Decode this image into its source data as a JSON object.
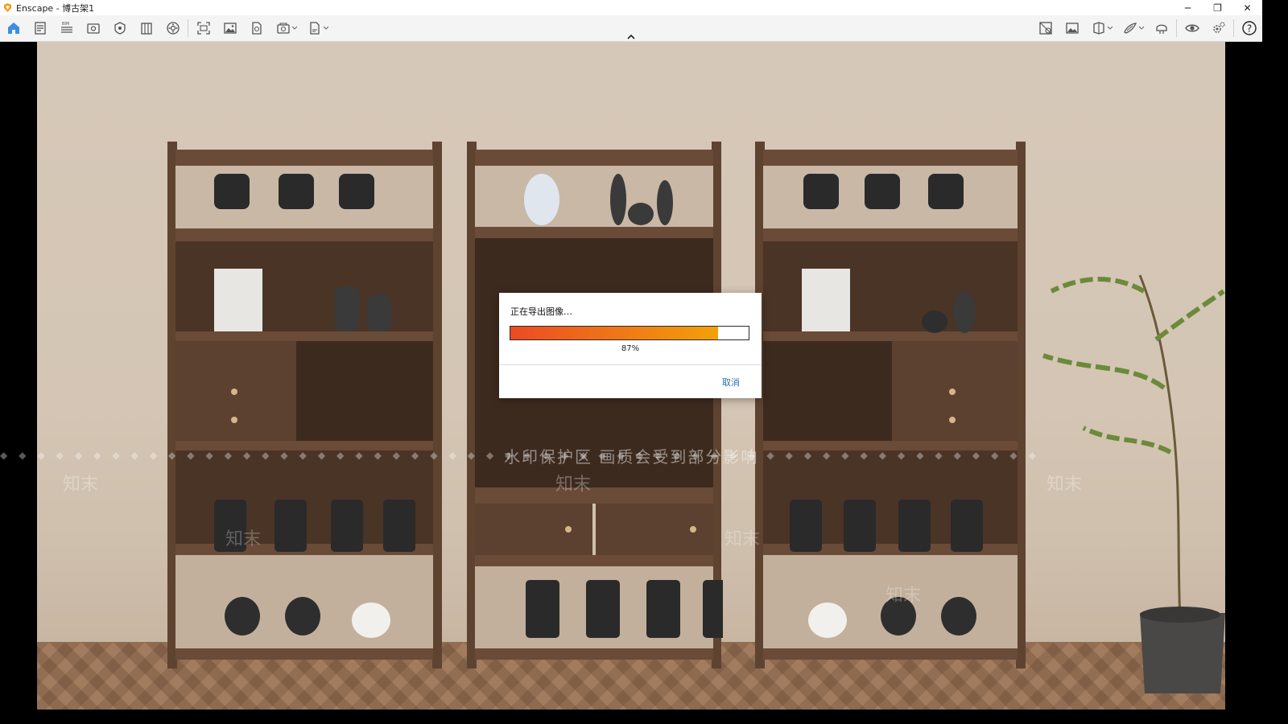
{
  "window": {
    "title": "Enscape - 博古架1",
    "minimize": "─",
    "restore": "❐",
    "close": "✕"
  },
  "toolbar": {
    "left_icons": [
      "home-icon",
      "assets-icon",
      "bim-icon",
      "views-icon",
      "visual-settings-icon",
      "library-icon",
      "atmosphere-icon",
      "capture-icon",
      "screenshot-icon",
      "export-icon",
      "batch-render-icon",
      "bookmark-icon"
    ],
    "right_icons": [
      "material-editor-icon",
      "image-library-icon",
      "section-view-icon",
      "annotation-icon",
      "vr-headset-icon",
      "preview-eye-icon",
      "settings-icon",
      "help-icon"
    ],
    "bim_label": "BIM"
  },
  "dialog": {
    "title": "正在导出图像…",
    "percent_text": "87%",
    "progress": 0.87,
    "cancel": "取消",
    "progress_colors": [
      "#ec4a24",
      "#f2a10a"
    ]
  },
  "watermark": {
    "text": "水印保护区   画质会受到部分影响",
    "brand": "知末"
  },
  "colors": {
    "accent": "#2b6cb0",
    "home_icon": "#3a8ee6"
  }
}
